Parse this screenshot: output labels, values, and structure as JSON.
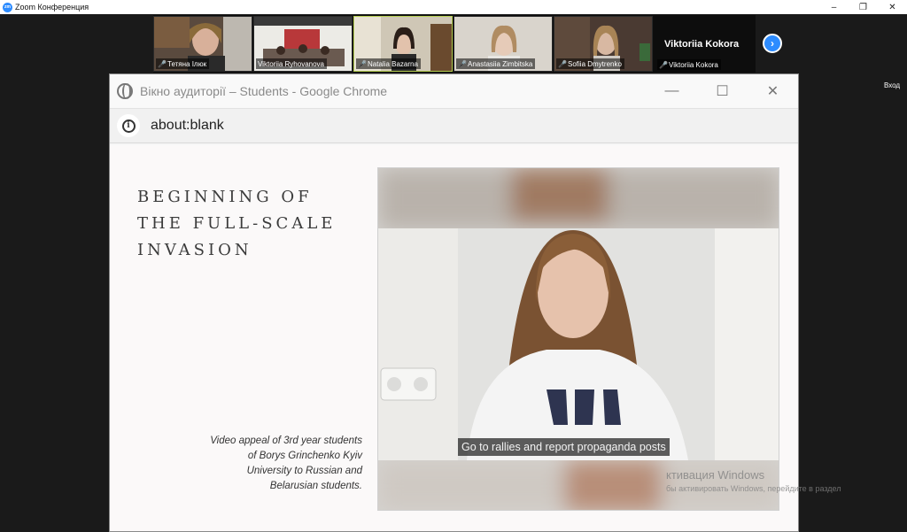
{
  "zoom": {
    "logo_text": "zm",
    "window_title": "Zoom Конференция",
    "minimize": "–",
    "restore": "❐",
    "close": "✕"
  },
  "participants": [
    {
      "name": "Тетяна Ілюк"
    },
    {
      "name": "Viktoriia Ryhovanova"
    },
    {
      "name": "Natalia Bazarna"
    },
    {
      "name": "Anastasiia Zimbitska"
    },
    {
      "name": "Sofiia Dmytrenko"
    },
    {
      "name": "Viktoriia Kokora"
    }
  ],
  "active_speaker_name": "Viktoriia Kokora",
  "next_page_glyph": "›",
  "side_label": "Вход",
  "chrome": {
    "title": "Вікно аудиторії – Students - Google Chrome",
    "url": "about:blank",
    "info_glyph": "i",
    "minimize": "—",
    "maximize": "☐",
    "close": "✕"
  },
  "slide": {
    "heading_lines": [
      "BEGINNING OF",
      "THE FULL-SCALE",
      "INVASION"
    ],
    "caption_lines": [
      "Video appeal of 3rd year students",
      "of Borys Grinchenko Kyiv",
      "University to Russian and",
      "Belarusian students."
    ],
    "video_subtitle": "Go to rallies and report propaganda posts"
  },
  "watermark": {
    "line1": "ктивация Windows",
    "line2": "бы активировать Windows, перейдите в раздел"
  },
  "colors": {
    "zoom_blue": "#2d8cff",
    "active_border": "#b6cf52",
    "mic_off_red": "#e02828"
  }
}
